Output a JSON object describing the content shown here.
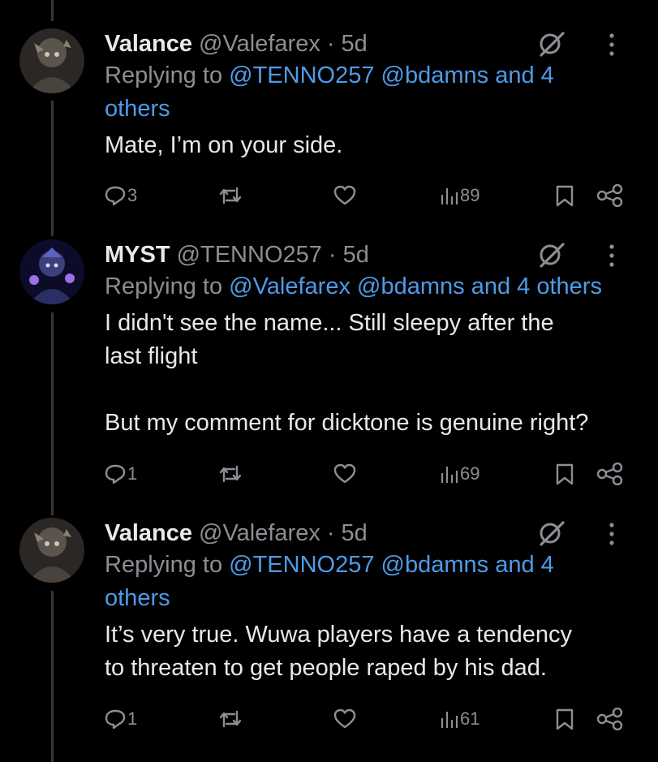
{
  "tweets": [
    {
      "name": "Valance",
      "handle": "@Valefarex",
      "time": "5d",
      "replying_label": "Replying to",
      "mention_1": "@TENNO257",
      "mention_2": "@bdamns",
      "and_others": "and 4 others",
      "body": [
        "Mate, I’m on your side."
      ],
      "replies": "3",
      "views": "89"
    },
    {
      "name": "MYST",
      "handle": "@TENNO257",
      "time": "5d",
      "replying_label": "Replying to",
      "mention_1": "@Valefarex",
      "mention_2": "@bdamns",
      "and_others": "and 4 others",
      "body": [
        "I didn't see the name... Still sleepy after the",
        "last flight",
        "",
        "But my comment for dicktone is genuine right?"
      ],
      "replies": "1",
      "views": "69"
    },
    {
      "name": "Valance",
      "handle": "@Valefarex",
      "time": "5d",
      "replying_label": "Replying to",
      "mention_1": "@TENNO257",
      "mention_2": "@bdamns",
      "and_others": "and 4 others",
      "body": [
        "It’s very true. Wuwa players have a tendency",
        "to threaten to get people raped by his dad."
      ],
      "replies": "1",
      "views": "61"
    }
  ],
  "separator": "·",
  "colors": {
    "background": "#000000",
    "text": "#e7e9ea",
    "muted": "#8b8f94",
    "link": "#4e9be8",
    "thread_line": "#333639"
  },
  "icons": [
    "grok-icon",
    "more-icon",
    "reply-icon",
    "retweet-icon",
    "like-icon",
    "views-icon",
    "bookmark-icon",
    "share-icon"
  ]
}
